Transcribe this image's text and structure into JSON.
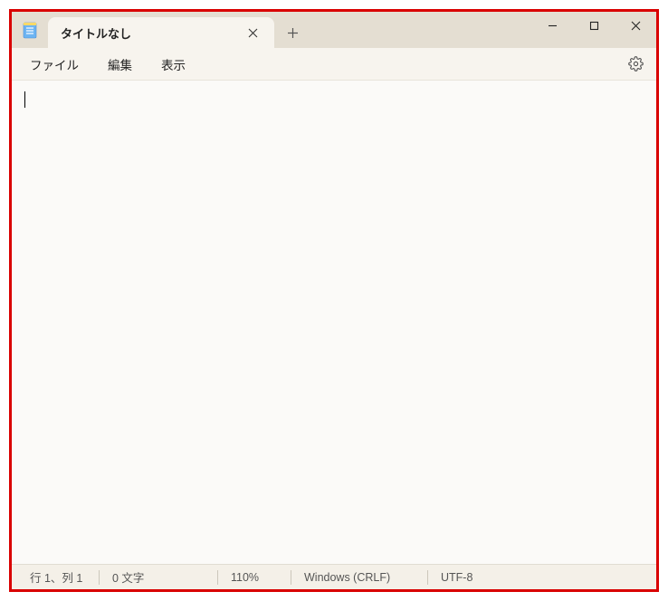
{
  "tab": {
    "title": "タイトルなし"
  },
  "menu": {
    "file": "ファイル",
    "edit": "編集",
    "view": "表示"
  },
  "status": {
    "position": "行 1、列 1",
    "chars": "0 文字",
    "zoom": "110%",
    "line_ending": "Windows (CRLF)",
    "encoding": "UTF-8"
  }
}
